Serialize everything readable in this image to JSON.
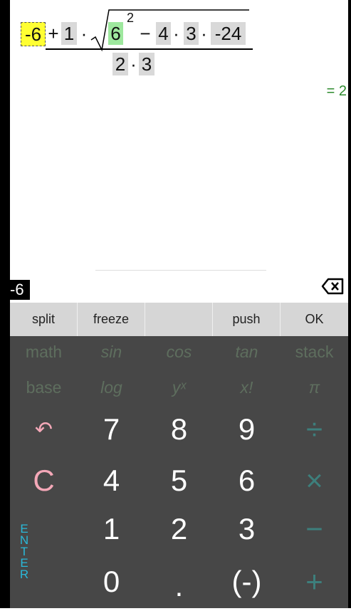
{
  "expression": {
    "first": "-6",
    "plus": "+",
    "one": "1",
    "dot1": "·",
    "sqrt_base": "6",
    "exponent": "2",
    "minus": "−",
    "four": "4",
    "dot2": "·",
    "three": "3",
    "dot3": "·",
    "neg24": "-24",
    "den_two": "2",
    "den_dot": "·",
    "den_three": "3"
  },
  "result": "= 2",
  "input_value": "-6",
  "toolbar": [
    "split",
    "freeze",
    "",
    "push",
    "OK"
  ],
  "function_rows": [
    [
      "math",
      "sin",
      "cos",
      "tan",
      "stack"
    ],
    [
      "base",
      "log",
      "yˣ",
      "x!",
      "π"
    ]
  ],
  "keys": {
    "undo": "↶",
    "seven": "7",
    "eight": "8",
    "nine": "9",
    "divide": "÷",
    "clear": "C",
    "four": "4",
    "five": "5",
    "six": "6",
    "multiply": "×",
    "one": "1",
    "two": "2",
    "three": "3",
    "minus": "−",
    "enter": [
      "E",
      "N",
      "T",
      "E",
      "R"
    ],
    "zero": "0",
    "decimal": ".",
    "negate": "(-)",
    "plus": "+"
  },
  "colors": {
    "result": "#2e8b2e",
    "keypad_bg": "#474747",
    "enter": "#2ab8d8",
    "clear": "#f4a8b8",
    "operator": "#3d7f7c"
  }
}
